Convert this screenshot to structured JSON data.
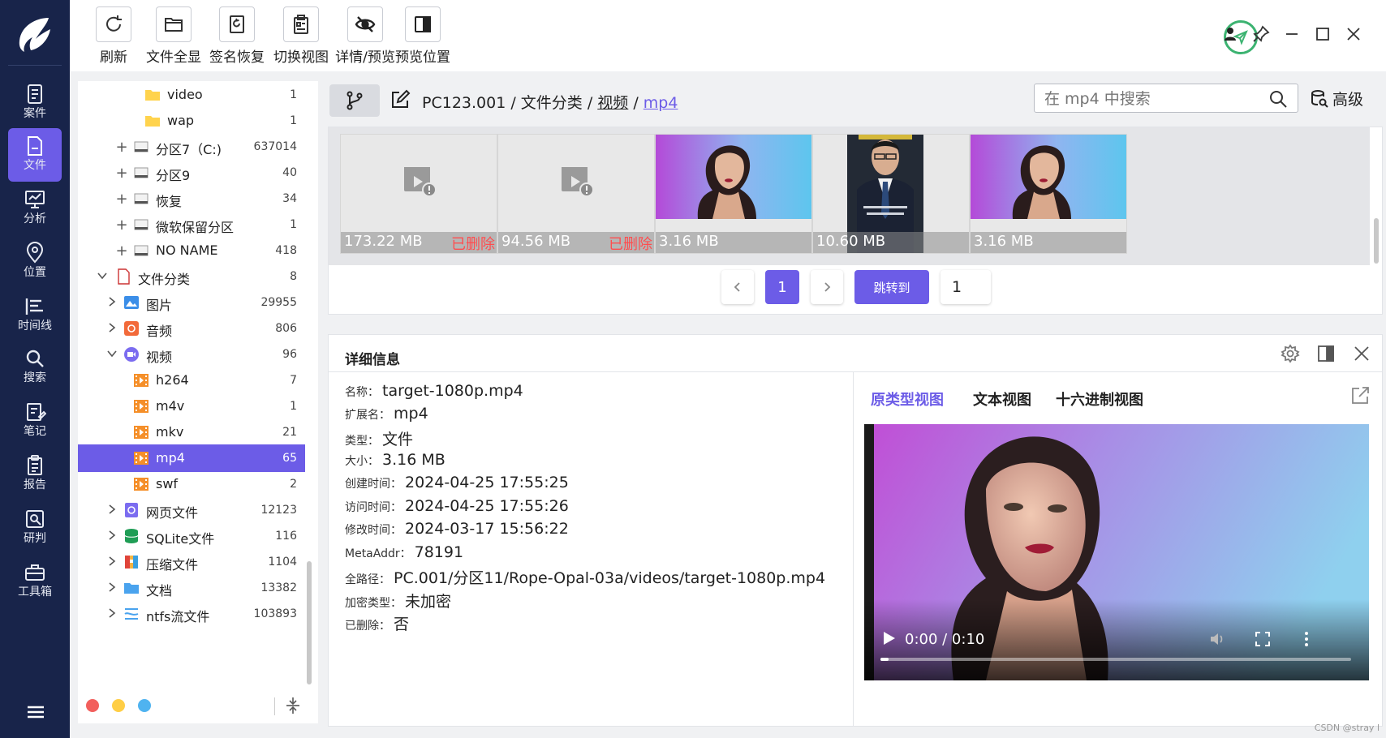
{
  "nav": {
    "items": [
      {
        "label": "案件",
        "icon": "case-icon"
      },
      {
        "label": "文件",
        "icon": "file-icon",
        "active": true
      },
      {
        "label": "分析",
        "icon": "analysis-icon"
      },
      {
        "label": "位置",
        "icon": "location-icon"
      },
      {
        "label": "时间线",
        "icon": "timeline-icon"
      },
      {
        "label": "搜索",
        "icon": "search-icon"
      },
      {
        "label": "笔记",
        "icon": "note-icon"
      },
      {
        "label": "报告",
        "icon": "report-icon"
      },
      {
        "label": "研判",
        "icon": "judge-icon"
      },
      {
        "label": "工具箱",
        "icon": "toolbox-icon"
      }
    ]
  },
  "toolbar": {
    "refresh": "刷新",
    "show_all": "文件全显",
    "sign_restore": "签名恢复",
    "switch_view": "切换视图",
    "detail_preview": "详情/预览",
    "preview_position": "预览位置"
  },
  "tree": {
    "rows": [
      {
        "name": "video",
        "count": "1",
        "icon": "folder-icon"
      },
      {
        "name": "wap",
        "count": "1",
        "icon": "folder-icon"
      },
      {
        "name": "分区7（C:)",
        "count": "637014",
        "icon": "drive-icon",
        "toggle": "+"
      },
      {
        "name": "分区9",
        "count": "40",
        "icon": "drive-icon",
        "toggle": "+"
      },
      {
        "name": "恢复",
        "count": "34",
        "icon": "drive-icon",
        "toggle": "+"
      },
      {
        "name": "微软保留分区",
        "count": "1",
        "icon": "drive-icon",
        "toggle": "+"
      },
      {
        "name": "NO NAME",
        "count": "418",
        "icon": "drive-icon",
        "toggle": "+"
      },
      {
        "name": "文件分类",
        "count": "8",
        "icon": "doc-icon",
        "toggle": "v"
      },
      {
        "name": "图片",
        "count": "29955",
        "icon": "image-icon",
        "toggle": ">"
      },
      {
        "name": "音频",
        "count": "806",
        "icon": "audio-icon",
        "toggle": ">"
      },
      {
        "name": "视频",
        "count": "96",
        "icon": "video-icon",
        "toggle": "v"
      },
      {
        "name": "h264",
        "count": "7",
        "icon": "film-icon"
      },
      {
        "name": "m4v",
        "count": "1",
        "icon": "film-icon"
      },
      {
        "name": "mkv",
        "count": "21",
        "icon": "film-icon"
      },
      {
        "name": "mp4",
        "count": "65",
        "icon": "film-icon",
        "selected": true
      },
      {
        "name": "swf",
        "count": "2",
        "icon": "film-icon"
      },
      {
        "name": "网页文件",
        "count": "12123",
        "icon": "web-icon",
        "toggle": ">"
      },
      {
        "name": "SQLite文件",
        "count": "116",
        "icon": "database-icon",
        "toggle": ">"
      },
      {
        "name": "压缩文件",
        "count": "1104",
        "icon": "archive-icon",
        "toggle": ">"
      },
      {
        "name": "文档",
        "count": "13382",
        "icon": "document-icon",
        "toggle": ">"
      },
      {
        "name": "ntfs流文件",
        "count": "103893",
        "icon": "stream-icon",
        "toggle": ">"
      }
    ],
    "dot_colors": [
      "#f25f5c",
      "#ffce45",
      "#4fb3f0"
    ]
  },
  "breadcrumb": {
    "root": "PC123.001",
    "sep": " / ",
    "level1": "文件分类",
    "level2": "视频",
    "current": "mp4"
  },
  "search": {
    "placeholder": "在 mp4 中搜索",
    "advanced": "高级"
  },
  "thumbs": [
    {
      "size": "173.22 MB",
      "deleted": "已删除",
      "kind": "placeholder"
    },
    {
      "size": "94.56 MB",
      "deleted": "已删除",
      "kind": "placeholder"
    },
    {
      "size": "3.16 MB",
      "deleted": "",
      "kind": "portrait"
    },
    {
      "size": "10.60 MB",
      "deleted": "",
      "kind": "man"
    },
    {
      "size": "3.16 MB",
      "deleted": "",
      "kind": "portrait"
    }
  ],
  "pager": {
    "current": "1",
    "jump_label": "跳转到",
    "input_value": "1"
  },
  "details": {
    "title": "详细信息",
    "props": [
      {
        "key": "名称：",
        "value": "target-1080p.mp4"
      },
      {
        "key": "扩展名：",
        "value": "mp4"
      },
      {
        "key": "类型：",
        "value": "文件"
      },
      {
        "key": "大小：",
        "value": "3.16 MB"
      },
      {
        "key": "创建时间：",
        "value": "2024-04-25 17:55:25"
      },
      {
        "key": "访问时间：",
        "value": "2024-04-25 17:55:26"
      },
      {
        "key": "修改时间：",
        "value": "2024-03-17 15:56:22"
      },
      {
        "key": "MetaAddr：",
        "value": "78191"
      },
      {
        "key": "全路径：",
        "value": "PC.001/分区11/Rope-Opal-03a/videos/target-1080p.mp4"
      },
      {
        "key": "加密类型：",
        "value": "未加密"
      },
      {
        "key": "已删除：",
        "value": "否"
      }
    ],
    "tabs": [
      "原类型视图",
      "文本视图",
      "十六进制视图"
    ],
    "video_time": "0:00 / 0:10",
    "video_progress": 0.0
  },
  "watermark": "CSDN @stray l",
  "colors": {
    "accent": "#6c5ce7",
    "nav_bg": "#18244a",
    "deleted_red": "#ff4d4f",
    "ok_green": "#3cb371"
  }
}
